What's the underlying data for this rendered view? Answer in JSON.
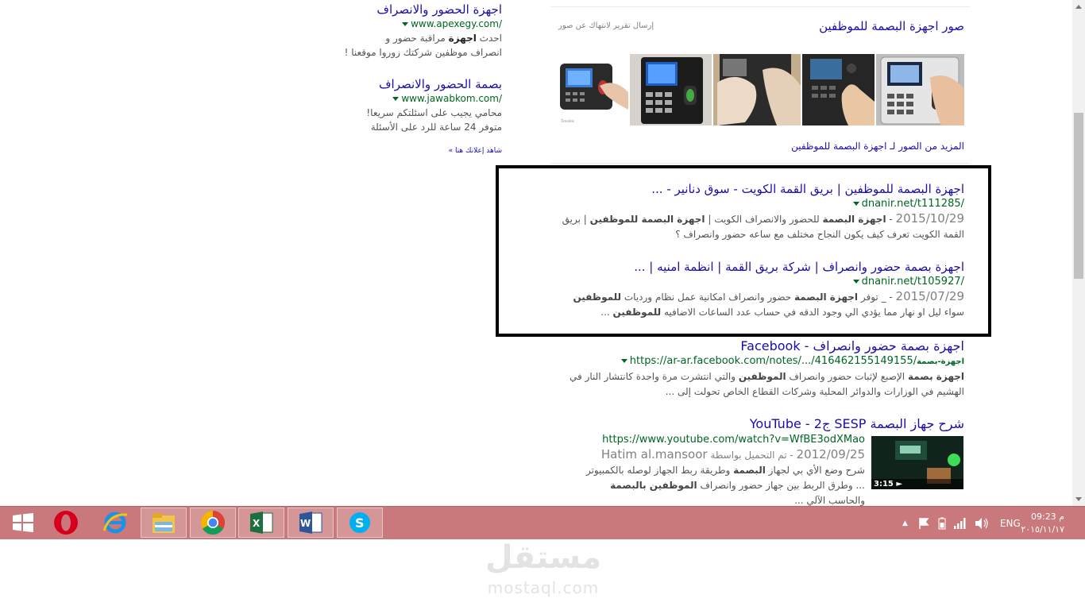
{
  "ads": [
    {
      "title": "اجهزة الحضور والانصراف",
      "url": "www.apexegy.com/",
      "desc_parts": [
        "احدث ",
        "اجهزة",
        " مراقبة حضور و"
      ],
      "desc2": "انصراف موظفين شركتك زوروا موقعنا !"
    },
    {
      "title": "بصمة الحضور والانصراف",
      "url": "www.jawabkom.com/",
      "desc1": "محامي يجيب على اسئلتكم سريعا!",
      "desc2": "متوفر 24 ساعة للرد على الأسئلة"
    }
  ],
  "see_ads": "شاهد إعلانك هنا »",
  "images_block": {
    "title": "صور اجهزة البصمة للموظفين",
    "report": "إرسال تقرير لانتهاك عن صور",
    "more": "المزيد من الصور لـ اجهزة البصمة للموظفين"
  },
  "results": [
    {
      "title": "اجهزة البصمة للموظفين | بريق القمة الكويت - سوق دنانير - ...",
      "url": "dnanir.net/t111285/",
      "date": "2015/10/29",
      "snippet1_parts": [
        " - ",
        "اجهزة البصمة",
        " للحضور والانصراف الكويت | ",
        "اجهزة البصمة للموظفين",
        " | بريق"
      ],
      "snippet2": "القمة الكويت تعرف كيف يكون النجاح مختلف مع ساعه حضور وانصراف ؟"
    },
    {
      "title": "اجهزة بصمة حضور وانصراف | شركة بريق القمة | انظمة امنيه | ...",
      "url": "dnanir.net/t105927/",
      "date": "2015/07/29",
      "snippet1_parts": [
        " - _ توفر ",
        "اجهزة البصمة",
        " حضور وانصراف امكانية عمل نظام ورديات ",
        "للموظفين"
      ],
      "snippet2_parts": [
        "سواء ليل او نهار مما يؤدي الي وجود الدقه في حساب عدد الساعات الاضافيه ",
        "للموظفين",
        " ..."
      ]
    },
    {
      "title": "اجهزة بصمة حضور وانصراف - Facebook",
      "url_bold": "اجهزة-بصمة",
      "url": "https://ar-ar.facebook.com/notes/.../416462155149155/",
      "snippet1_parts": [
        "اجهزة بصمة",
        " الإصبع لإثبات حضور وانصراف ",
        "الموظفين",
        " والتي انتشرت مرة واحدة كانتشار النار في"
      ],
      "snippet2": "الهشيم في الوزارات والدوائر المحلية وشركات القطاع الخاص تحولت إلى ..."
    },
    {
      "title": "شرح جهاز البصمة SESP ج2 - YouTube",
      "url": "https://www.youtube.com/watch?v=WfBE3odXMao",
      "date": "2012/09/25",
      "uploaded": " - تم التحميل بواسطة ",
      "author": "Hatim al.mansoor",
      "snippet1_parts": [
        "شرح وضع الأي بي لجهاز ",
        "البصمة",
        " وطريقة ربط الجهاز لوصله بالكمبيوتر"
      ],
      "snippet2_parts": [
        "... وطرق الربط بين جهاز حضور وانصراف ",
        "الموظفين بالبصمة"
      ],
      "snippet3": "والحاسب الآلي ...",
      "duration": "3:15 ►"
    }
  ],
  "taskbar": {
    "apps": [
      "start-icon",
      "opera-icon",
      "internet-explorer-icon",
      "file-explorer-icon",
      "chrome-icon",
      "excel-icon",
      "word-icon",
      "skype-icon"
    ],
    "lang": "ENG",
    "time": "09:23 م",
    "date": "٢٠١٥/١١/١٧"
  },
  "watermark": {
    "ar": "مستقل",
    "en": "mostaql.com"
  },
  "colors": {
    "link": "#1a0dab",
    "url": "#006621",
    "snippet": "#545454",
    "taskbar": "#c9797c"
  }
}
